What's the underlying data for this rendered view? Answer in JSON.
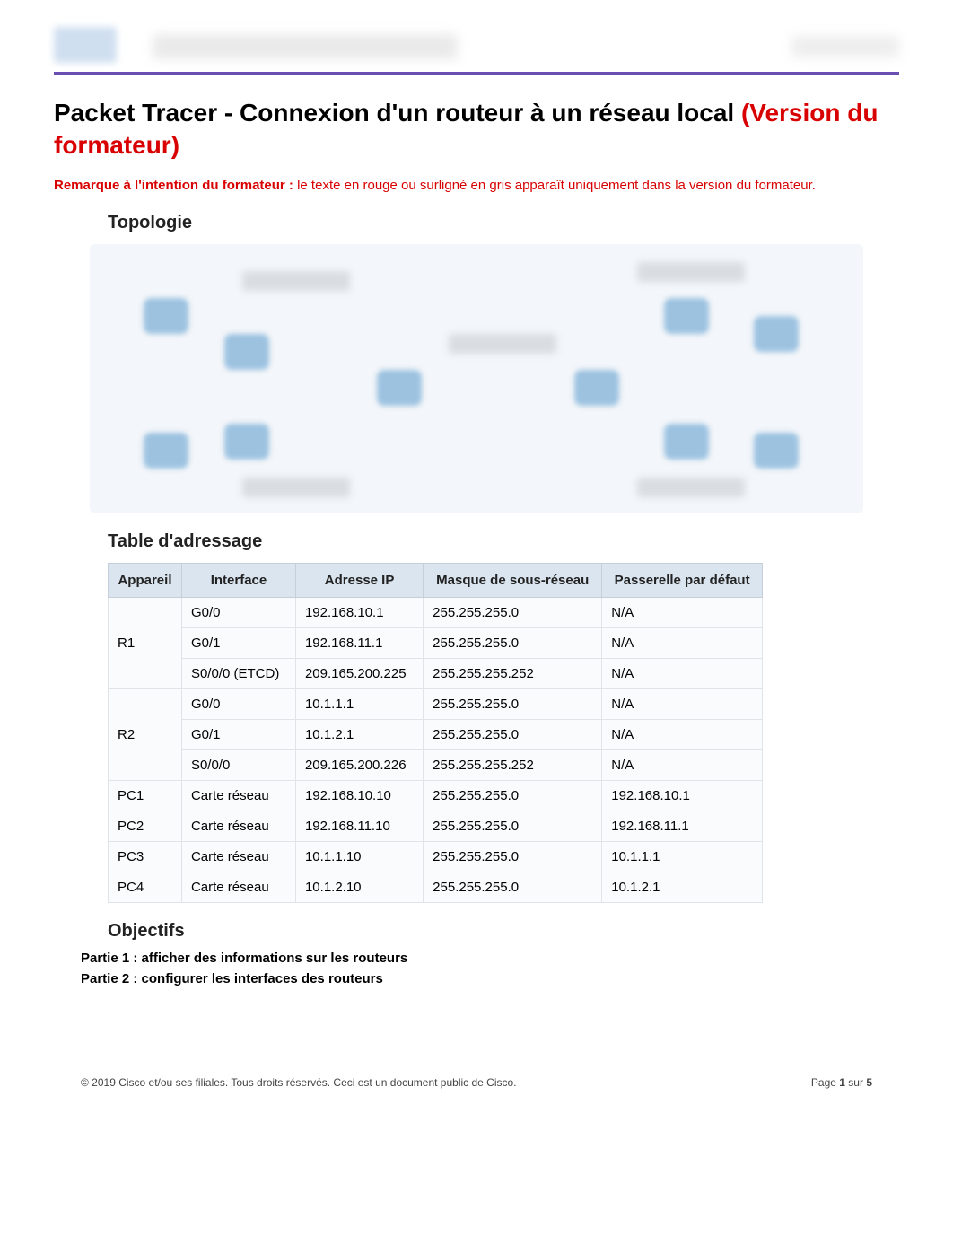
{
  "title": {
    "main": "Packet Tracer - Connexion d'un routeur à un réseau local ",
    "red": "(Version du formateur)"
  },
  "note": {
    "bold": "Remarque à l'intention du formateur : ",
    "text": "le texte en rouge ou surligné en gris apparaît uniquement dans la version du formateur."
  },
  "sections": {
    "topology": "Topologie",
    "addressing": "Table d'adressage",
    "objectives": "Objectifs"
  },
  "table": {
    "headers": {
      "device": "Appareil",
      "interface": "Interface",
      "ip": "Adresse IP",
      "mask": "Masque de sous-réseau",
      "gateway": "Passerelle par défaut"
    },
    "rows": [
      {
        "device": "R1",
        "interface": "G0/0",
        "ip": "192.168.10.1",
        "mask": "255.255.255.0",
        "gateway": "N/A"
      },
      {
        "device": "R1",
        "interface": "G0/1",
        "ip": "192.168.11.1",
        "mask": "255.255.255.0",
        "gateway": "N/A"
      },
      {
        "device": "R1",
        "interface": "S0/0/0 (ETCD)",
        "ip": "209.165.200.225",
        "mask": "255.255.255.252",
        "gateway": "N/A"
      },
      {
        "device": "R2",
        "interface": "G0/0",
        "ip": "10.1.1.1",
        "mask": "255.255.255.0",
        "gateway": "N/A"
      },
      {
        "device": "R2",
        "interface": "G0/1",
        "ip": "10.1.2.1",
        "mask": "255.255.255.0",
        "gateway": "N/A"
      },
      {
        "device": "R2",
        "interface": "S0/0/0",
        "ip": "209.165.200.226",
        "mask": "255.255.255.252",
        "gateway": "N/A"
      },
      {
        "device": "PC1",
        "interface": "Carte réseau",
        "ip": "192.168.10.10",
        "mask": "255.255.255.0",
        "gateway": "192.168.10.1"
      },
      {
        "device": "PC2",
        "interface": "Carte réseau",
        "ip": "192.168.11.10",
        "mask": "255.255.255.0",
        "gateway": "192.168.11.1"
      },
      {
        "device": "PC3",
        "interface": "Carte réseau",
        "ip": "10.1.1.10",
        "mask": "255.255.255.0",
        "gateway": "10.1.1.1"
      },
      {
        "device": "PC4",
        "interface": "Carte réseau",
        "ip": "10.1.2.10",
        "mask": "255.255.255.0",
        "gateway": "10.1.2.1"
      }
    ]
  },
  "objectives": [
    "Partie 1 : afficher des informations sur les routeurs",
    "Partie 2 : configurer les interfaces des routeurs"
  ],
  "footer": {
    "left": "© 2019 Cisco et/ou ses filiales. Tous droits réservés. Ceci est un document public de Cisco.",
    "page_label_before": "Page ",
    "page_current": "1",
    "page_label_mid": " sur ",
    "page_total": "5"
  }
}
